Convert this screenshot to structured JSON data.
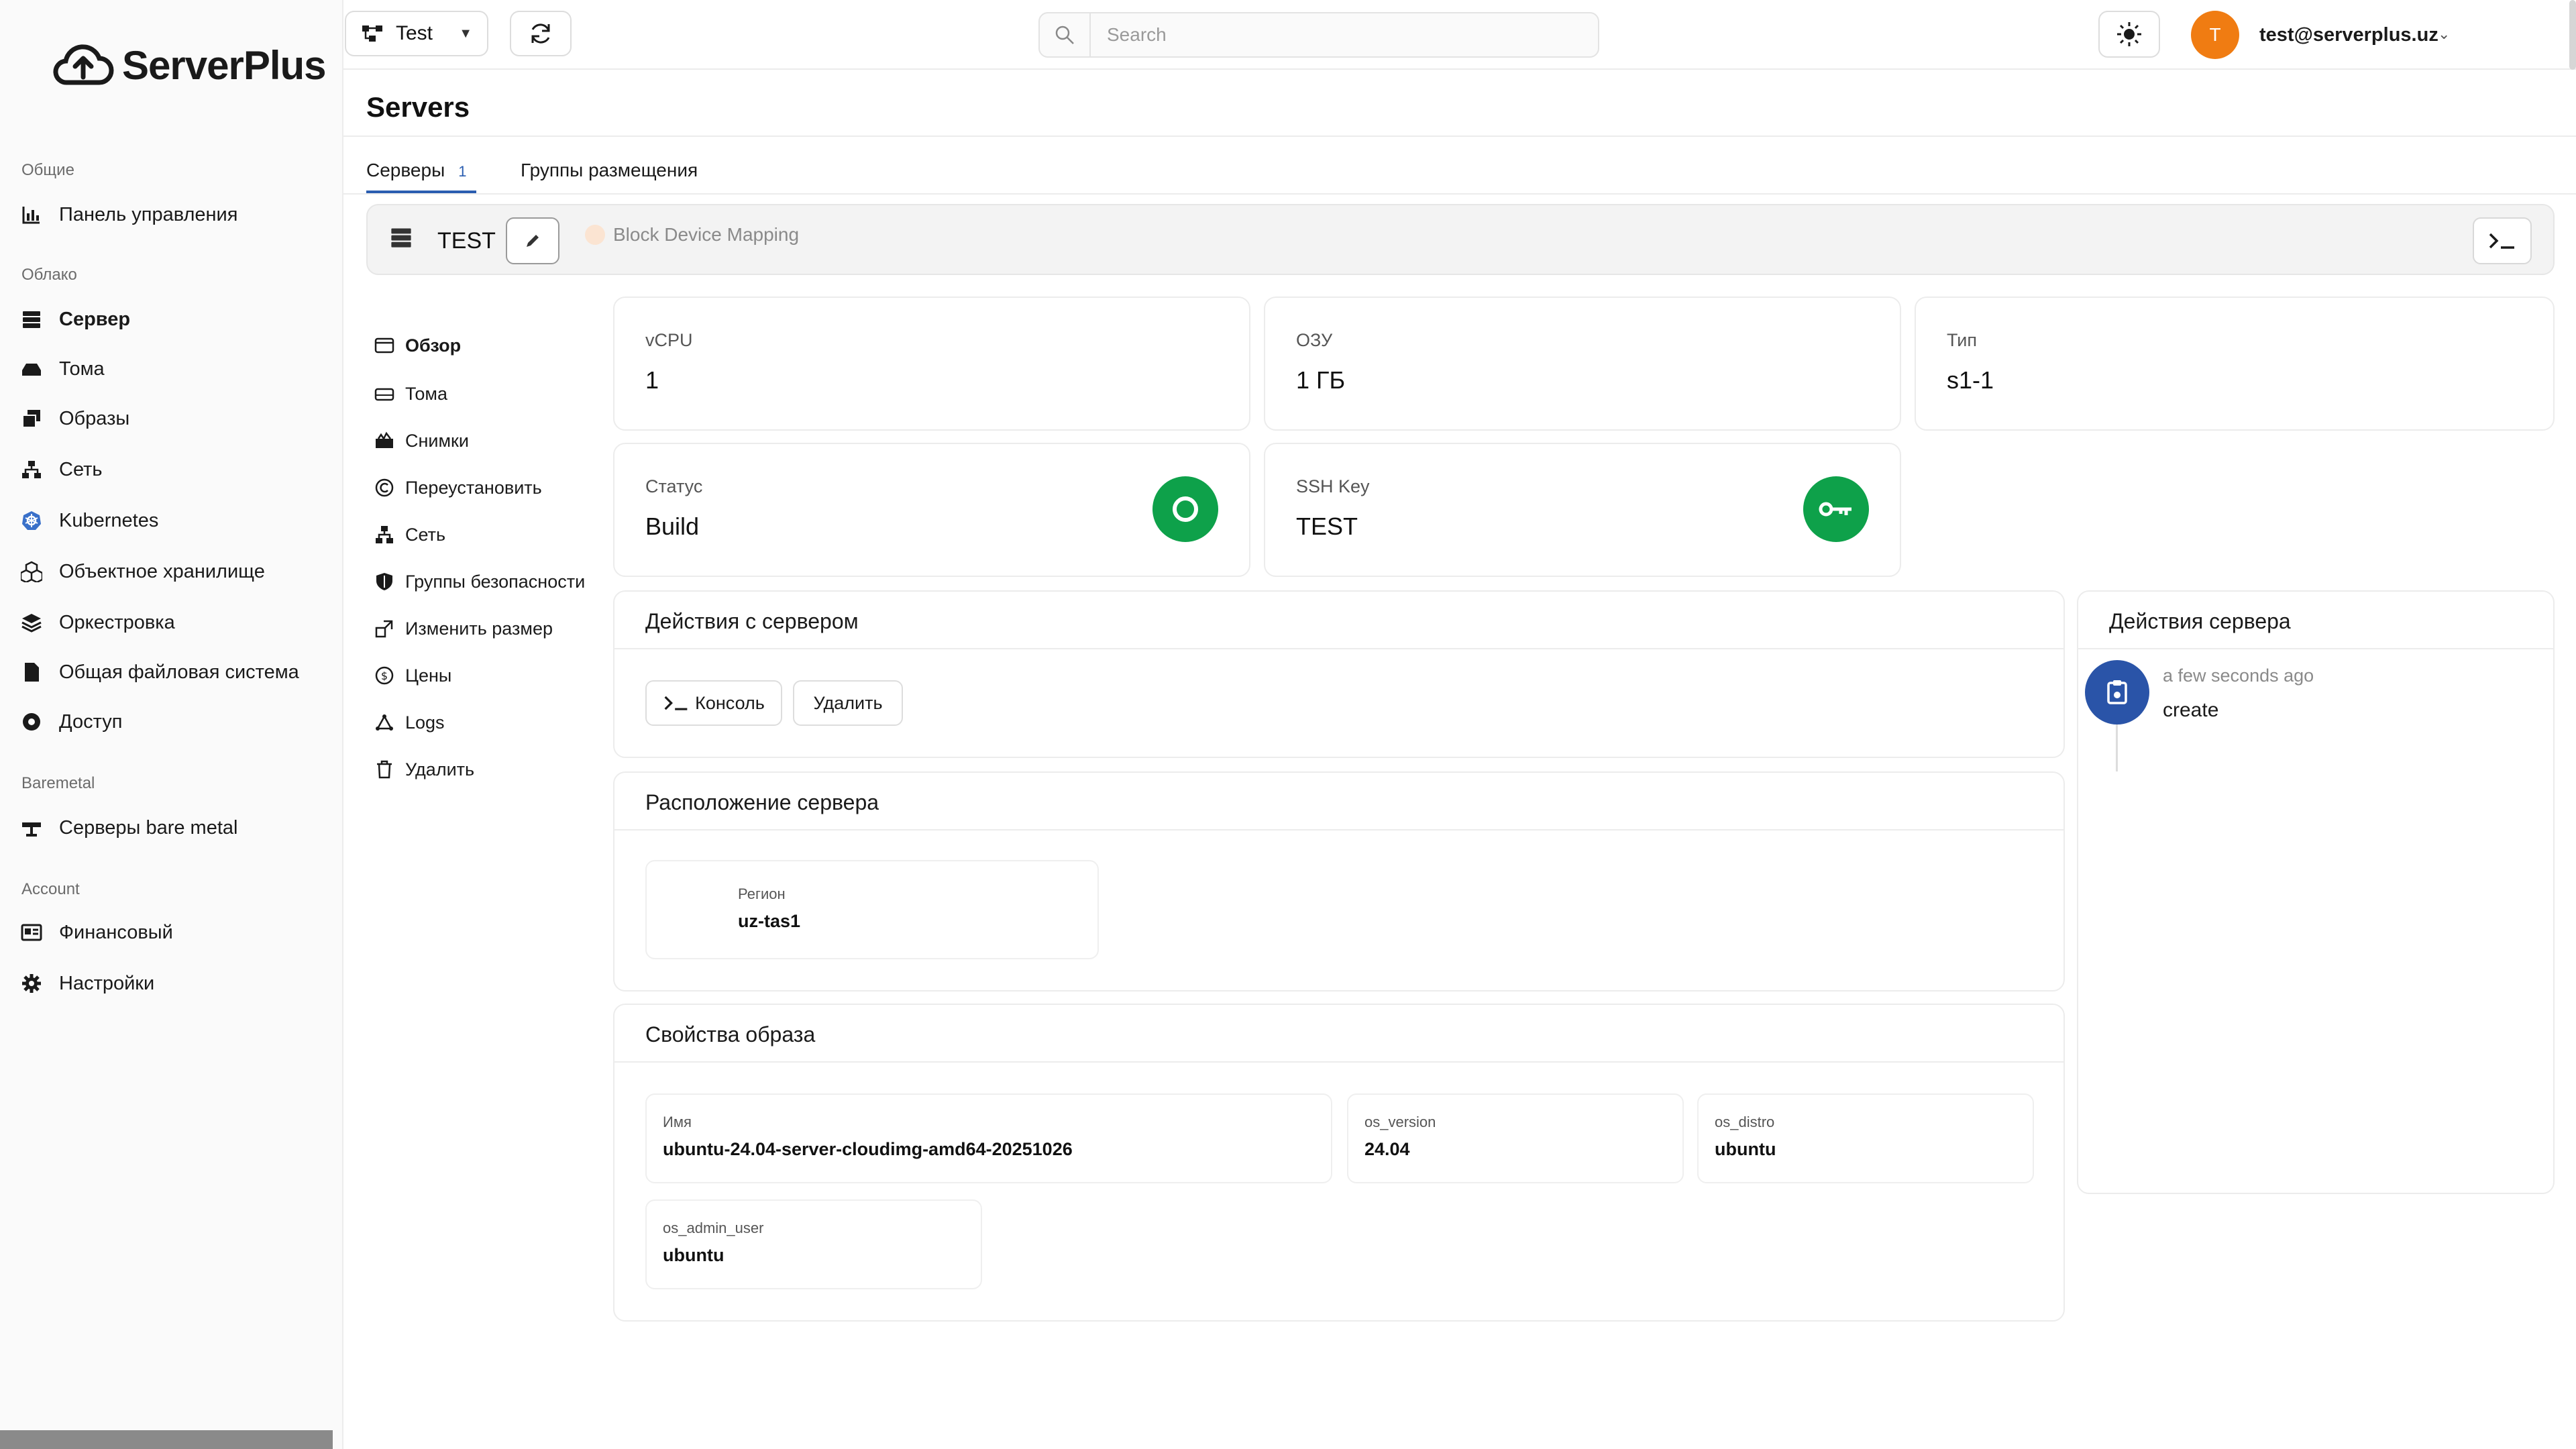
{
  "brand": {
    "name": "ServerPlus"
  },
  "sidebar": {
    "groups": [
      {
        "label": "Общие"
      },
      {
        "label": "Облако"
      },
      {
        "label": "Baremetal"
      },
      {
        "label": "Account"
      }
    ],
    "items": [
      {
        "label": "Панель управления",
        "icon": "chart-icon"
      },
      {
        "label": "Сервер",
        "icon": "server-icon"
      },
      {
        "label": "Тома",
        "icon": "drive-icon"
      },
      {
        "label": "Образы",
        "icon": "images-icon"
      },
      {
        "label": "Сеть",
        "icon": "network-icon"
      },
      {
        "label": "Kubernetes",
        "icon": "kubernetes-icon"
      },
      {
        "label": "Объектное хранилище",
        "icon": "boxes-icon"
      },
      {
        "label": "Оркестровка",
        "icon": "layers-icon"
      },
      {
        "label": "Общая файловая система",
        "icon": "file-icon"
      },
      {
        "label": "Доступ",
        "icon": "circle-icon"
      },
      {
        "label": "Серверы bare metal",
        "icon": "baremetal-icon"
      },
      {
        "label": "Финансовый",
        "icon": "billing-icon"
      },
      {
        "label": "Настройки",
        "icon": "gear-icon"
      }
    ]
  },
  "topbar": {
    "project": "Test",
    "search_placeholder": "Search",
    "avatar_letter": "T",
    "user_email": "test@serverplus.uz"
  },
  "page": {
    "title": "Servers",
    "tabs": [
      {
        "label": "Серверы",
        "count": "1"
      },
      {
        "label": "Группы размещения"
      }
    ]
  },
  "server": {
    "name": "TEST",
    "block_device_label": "Block Device Mapping"
  },
  "submenu": [
    {
      "label": "Обзор"
    },
    {
      "label": "Тома"
    },
    {
      "label": "Снимки"
    },
    {
      "label": "Переустановить"
    },
    {
      "label": "Сеть"
    },
    {
      "label": "Группы безопасности"
    },
    {
      "label": "Изменить размер"
    },
    {
      "label": "Цены"
    },
    {
      "label": "Logs"
    },
    {
      "label": "Удалить"
    }
  ],
  "specs": {
    "vcpu": {
      "label": "vCPU",
      "value": "1"
    },
    "ram": {
      "label": "ОЗУ",
      "value": "1 ГБ"
    },
    "type": {
      "label": "Тип",
      "value": "s1-1"
    },
    "status": {
      "label": "Статус",
      "value": "Build"
    },
    "ssh": {
      "label": "SSH Key",
      "value": "TEST"
    }
  },
  "actions_panel": {
    "title": "Действия с сервером",
    "console_label": "Консоль",
    "delete_label": "Удалить"
  },
  "location_panel": {
    "title": "Расположение сервера",
    "region_label": "Регион",
    "region_value": "uz-tas1"
  },
  "image_panel": {
    "title": "Свойства образа",
    "props": [
      {
        "label": "Имя",
        "value": "ubuntu-24.04-server-cloudimg-amd64-20251026"
      },
      {
        "label": "os_version",
        "value": "24.04"
      },
      {
        "label": "os_distro",
        "value": "ubuntu"
      },
      {
        "label": "os_admin_user",
        "value": "ubuntu"
      }
    ]
  },
  "history_panel": {
    "title": "Действия сервера",
    "events": [
      {
        "time": "a few seconds ago",
        "action": "create"
      }
    ]
  },
  "colors": {
    "accent": "#2a5db0",
    "status_green": "#0ea14a",
    "avatar_orange": "#f07c12",
    "timeline_blue": "#2a54a8"
  }
}
